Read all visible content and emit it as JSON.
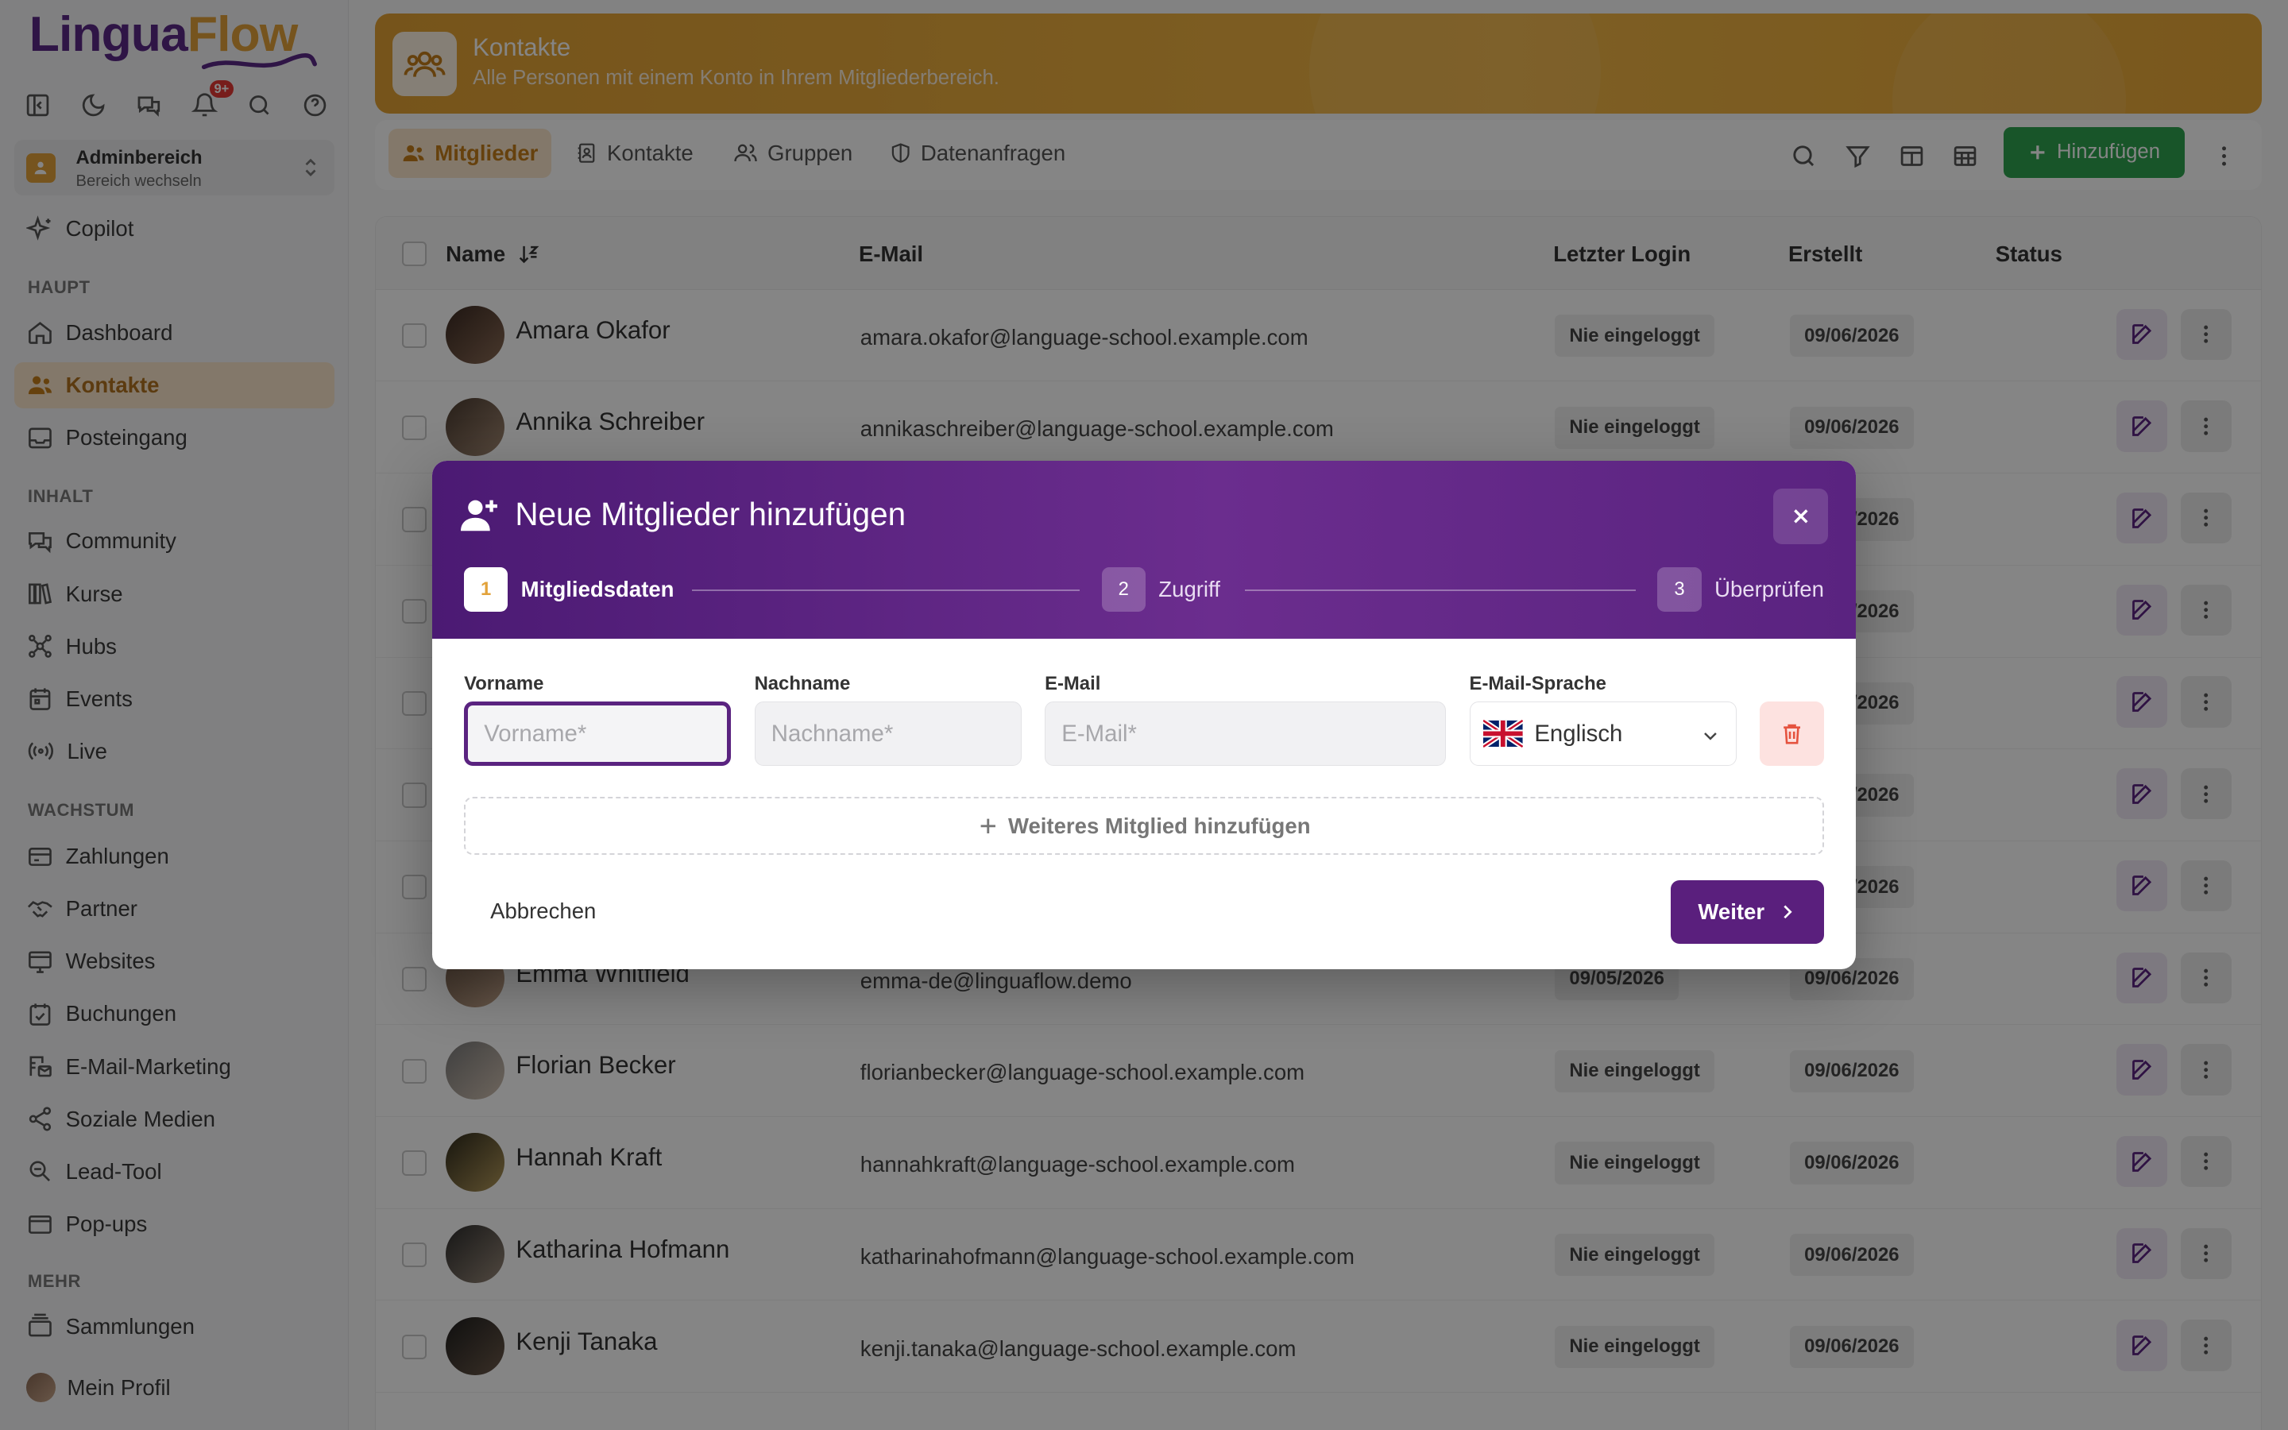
{
  "brand": {
    "part1": "Lingua",
    "part2": "Flow"
  },
  "notifications_badge": "9+",
  "switcher": {
    "title": "Adminbereich",
    "subtitle": "Bereich wechseln"
  },
  "nav": {
    "copilot": "Copilot",
    "sections": {
      "haupt": "HAUPT",
      "inhalt": "INHALT",
      "wachstum": "WACHSTUM",
      "mehr": "MEHR"
    },
    "dashboard": "Dashboard",
    "kontakte": "Kontakte",
    "posteingang": "Posteingang",
    "community": "Community",
    "kurse": "Kurse",
    "hubs": "Hubs",
    "events": "Events",
    "live": "Live",
    "zahlungen": "Zahlungen",
    "partner": "Partner",
    "websites": "Websites",
    "buchungen": "Buchungen",
    "email_marketing": "E-Mail-Marketing",
    "soziale_medien": "Soziale Medien",
    "lead_tool": "Lead-Tool",
    "popups": "Pop-ups",
    "sammlungen": "Sammlungen",
    "profil": "Mein Profil"
  },
  "banner": {
    "title": "Kontakte",
    "subtitle": "Alle Personen mit einem Konto in Ihrem Mitgliederbereich."
  },
  "tabs": {
    "mitglieder": "Mitglieder",
    "kontakte": "Kontakte",
    "gruppen": "Gruppen",
    "datenanfragen": "Datenanfragen"
  },
  "add_button": "Hinzufügen",
  "table": {
    "headers": {
      "name": "Name",
      "email": "E-Mail",
      "last_login": "Letzter Login",
      "created": "Erstellt",
      "status": "Status"
    },
    "rows": [
      {
        "name": "Amara Okafor",
        "email": "amara.okafor@language-school.example.com",
        "last_login": "Nie eingeloggt",
        "created": "09/06/2026"
      },
      {
        "name": "Annika Schreiber",
        "email": "annikaschreiber@language-school.example.com",
        "last_login": "Nie eingeloggt",
        "created": "09/06/2026"
      },
      {
        "name": "",
        "email": "",
        "last_login": "",
        "created": "09/06/2026"
      },
      {
        "name": "",
        "email": "",
        "last_login": "",
        "created": "09/06/2026"
      },
      {
        "name": "",
        "email": "",
        "last_login": "",
        "created": "09/06/2026"
      },
      {
        "name": "",
        "email": "",
        "last_login": "",
        "created": "09/06/2026"
      },
      {
        "name": "",
        "email": "",
        "last_login": "",
        "created": "09/06/2026"
      },
      {
        "name": "Emma Whitfield",
        "email": "emma-de@linguaflow.demo",
        "last_login": "09/05/2026",
        "created": "09/06/2026"
      },
      {
        "name": "Florian Becker",
        "email": "florianbecker@language-school.example.com",
        "last_login": "Nie eingeloggt",
        "created": "09/06/2026"
      },
      {
        "name": "Hannah Kraft",
        "email": "hannahkraft@language-school.example.com",
        "last_login": "Nie eingeloggt",
        "created": "09/06/2026"
      },
      {
        "name": "Katharina Hofmann",
        "email": "katharinahofmann@language-school.example.com",
        "last_login": "Nie eingeloggt",
        "created": "09/06/2026"
      },
      {
        "name": "Kenji Tanaka",
        "email": "kenji.tanaka@language-school.example.com",
        "last_login": "Nie eingeloggt",
        "created": "09/06/2026"
      }
    ]
  },
  "modal": {
    "title": "Neue Mitglieder hinzufügen",
    "steps": [
      {
        "num": "1",
        "label": "Mitgliedsdaten"
      },
      {
        "num": "2",
        "label": "Zugriff"
      },
      {
        "num": "3",
        "label": "Überprüfen"
      }
    ],
    "fields": {
      "vorname": {
        "label": "Vorname",
        "placeholder": "Vorname*",
        "value": ""
      },
      "nachname": {
        "label": "Nachname",
        "placeholder": "Nachname*",
        "value": ""
      },
      "email": {
        "label": "E-Mail",
        "placeholder": "E-Mail*",
        "value": ""
      },
      "sprache": {
        "label": "E-Mail-Sprache",
        "value": "Englisch"
      }
    },
    "add_more": "Weiteres Mitglied hinzufügen",
    "cancel": "Abbrechen",
    "next": "Weiter"
  },
  "colors": {
    "brand_purple": "#5a2380",
    "brand_orange": "#e2a23a",
    "primary_green": "#2ea44f"
  }
}
